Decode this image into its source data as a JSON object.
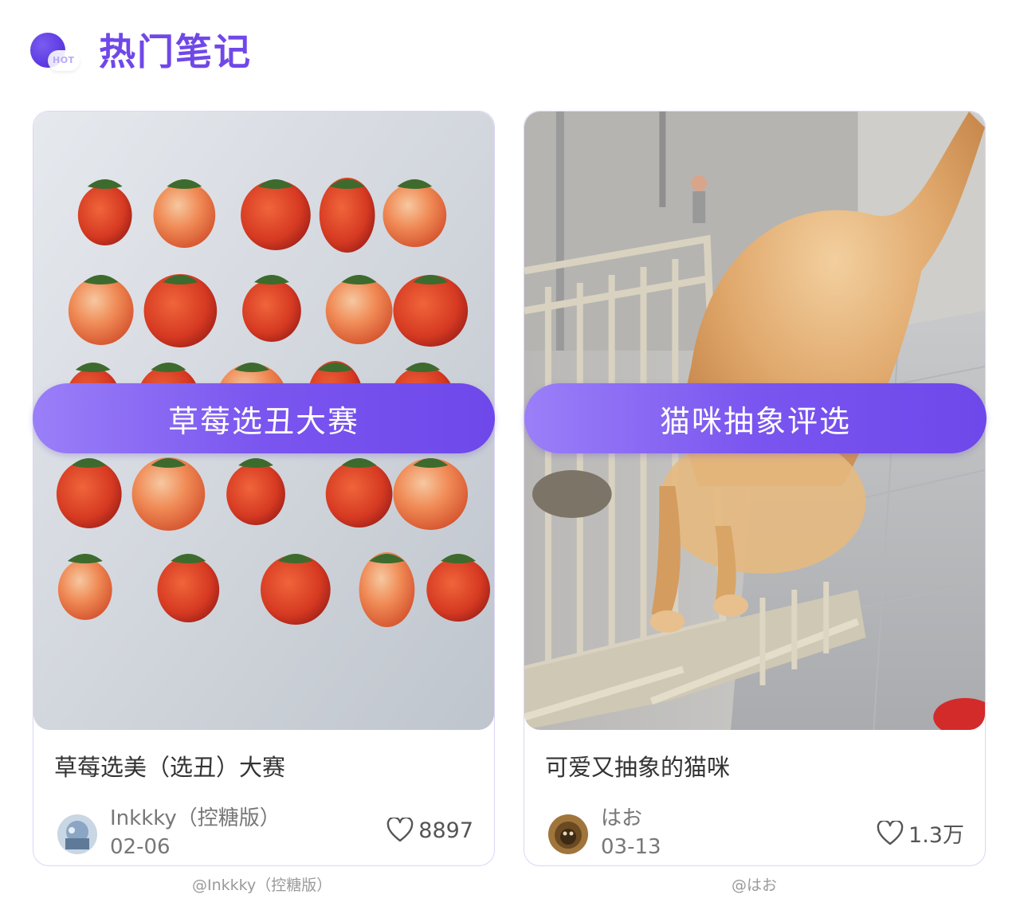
{
  "header": {
    "title": "热门笔记",
    "badge": "HOT",
    "accent": "#7048e8"
  },
  "cards": [
    {
      "image_icon": "strawberries-photo",
      "banner": "草莓选丑大赛",
      "title": "草莓选美（选丑）大赛",
      "author": "Inkkky（控糖版）",
      "date": "02-06",
      "likes": "8897",
      "credit": "@Inkkky（控糖版）"
    },
    {
      "image_icon": "cat-photo",
      "banner": "猫咪抽象评选",
      "title": "可爱又抽象的猫咪",
      "author": "はお",
      "date": "03-13",
      "likes": "1.3万",
      "credit": "@はお"
    }
  ],
  "colors": {
    "banner_start": "#9a7ff8",
    "banner_end": "#6e48ea",
    "card_border": "#dcd5f6"
  }
}
